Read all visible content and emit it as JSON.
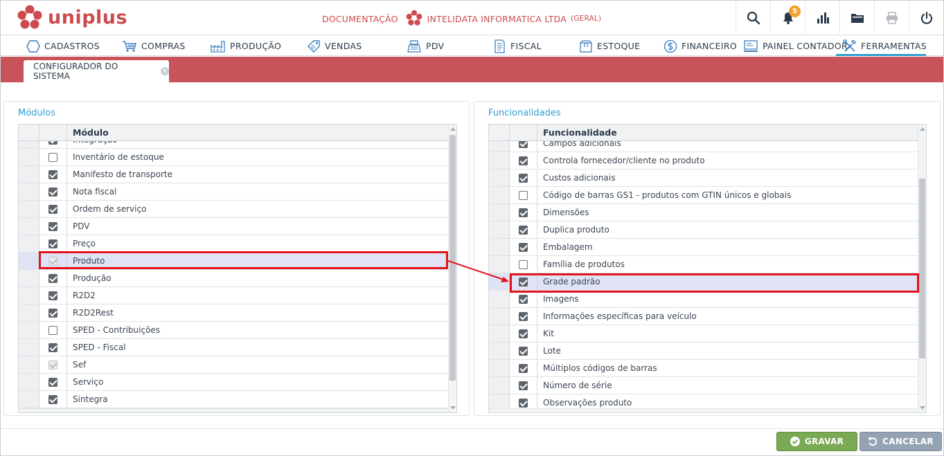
{
  "app": {
    "logo_text": "uniplus",
    "docs_label": "DOCUMENTAÇÃO",
    "company_name": "INTELIDATA INFORMATICA LTDA",
    "company_mode": "(GERAL)",
    "notifications_count": "5"
  },
  "top_actions": [
    {
      "name": "search-icon"
    },
    {
      "name": "bell-icon"
    },
    {
      "name": "bar-chart-icon"
    },
    {
      "name": "folder-icon"
    },
    {
      "name": "printer-icon",
      "disabled": true
    },
    {
      "name": "power-icon"
    }
  ],
  "nav": [
    {
      "label": "CADASTROS",
      "icon": "hexagon-icon"
    },
    {
      "label": "COMPRAS",
      "icon": "cart-icon"
    },
    {
      "label": "PRODUÇÃO",
      "icon": "factory-icon"
    },
    {
      "label": "VENDAS",
      "icon": "tag-icon"
    },
    {
      "label": "PDV",
      "icon": "pos-icon"
    },
    {
      "label": "FISCAL",
      "icon": "document-icon"
    },
    {
      "label": "ESTOQUE",
      "icon": "box-icon"
    },
    {
      "label": "FINANCEIRO",
      "icon": "dollar-icon"
    },
    {
      "label": "PAINEL CONTADOR",
      "icon": "monitor-icon"
    },
    {
      "label": "FERRAMENTAS",
      "icon": "tools-icon",
      "active": true
    }
  ],
  "document_tab": {
    "label": "CONFIGURADOR DO SISTEMA",
    "close": "×"
  },
  "modules": {
    "title": "Módulos",
    "column_header": "Módulo",
    "rows": [
      {
        "label": "Integração",
        "checked": true
      },
      {
        "label": "Inventário de estoque",
        "checked": false
      },
      {
        "label": "Manifesto de transporte",
        "checked": true
      },
      {
        "label": "Nota fiscal",
        "checked": true
      },
      {
        "label": "Ordem de serviço",
        "checked": true
      },
      {
        "label": "PDV",
        "checked": true
      },
      {
        "label": "Preço",
        "checked": true
      },
      {
        "label": "Produto",
        "checked": true,
        "disabled": true,
        "selected": true
      },
      {
        "label": "Produção",
        "checked": true
      },
      {
        "label": "R2D2",
        "checked": true
      },
      {
        "label": "R2D2Rest",
        "checked": true
      },
      {
        "label": "SPED - Contribuições",
        "checked": false
      },
      {
        "label": "SPED - Fiscal",
        "checked": true
      },
      {
        "label": "Sef",
        "checked": true,
        "disabled": true
      },
      {
        "label": "Serviço",
        "checked": true
      },
      {
        "label": "Sintegra",
        "checked": true
      },
      {
        "label": "",
        "checked": false
      }
    ]
  },
  "features": {
    "title": "Funcionalidades",
    "column_header": "Funcionalidade",
    "rows": [
      {
        "label": "Campos adicionais",
        "checked": true
      },
      {
        "label": "Controla fornecedor/cliente no produto",
        "checked": true
      },
      {
        "label": "Custos adicionais",
        "checked": true
      },
      {
        "label": "Código de barras GS1 - produtos com GTIN únicos e globais",
        "checked": false
      },
      {
        "label": "Dimensões",
        "checked": true
      },
      {
        "label": "Duplica produto",
        "checked": true
      },
      {
        "label": "Embalagem",
        "checked": true
      },
      {
        "label": "Família de produtos",
        "checked": false
      },
      {
        "label": "Grade padrão",
        "checked": true,
        "selected": true
      },
      {
        "label": "Imagens",
        "checked": true
      },
      {
        "label": "Informações específicas para veículo",
        "checked": true
      },
      {
        "label": "Kit",
        "checked": true
      },
      {
        "label": "Lote",
        "checked": true
      },
      {
        "label": "Múltiplos códigos de barras",
        "checked": true
      },
      {
        "label": "Número de série",
        "checked": true
      },
      {
        "label": "Observações produto",
        "checked": true
      }
    ]
  },
  "footer": {
    "save_label": "GRAVAR",
    "cancel_label": "CANCELAR"
  },
  "colors": {
    "brand": "#cd4b4e",
    "accent": "#2c9fd3",
    "band": "#c9535a",
    "save": "#7aaa53",
    "cancel": "#95a4b4",
    "highlight": "#e0141a"
  }
}
